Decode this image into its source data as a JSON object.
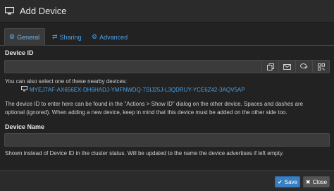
{
  "title": "Add Device",
  "tabs": [
    {
      "label": "General",
      "icon": "gear-icon"
    },
    {
      "label": "Sharing",
      "icon": "share-icon"
    },
    {
      "label": "Advanced",
      "icon": "gears-icon"
    }
  ],
  "device_id": {
    "label": "Device ID",
    "value": "",
    "addon_icons": [
      "copy-icon",
      "envelope-icon",
      "chat-icon",
      "qrcode-icon"
    ]
  },
  "nearby": {
    "intro": "You can also select one of these nearby devices:",
    "devices": [
      "MYEJ7AF-AX656EX-DH6HADJ-YMFNWDQ-7SIJ25J-L3QDRUY-YCE6Z42-3AQV5AP"
    ]
  },
  "help_text": [
    "The device ID to enter here can be found in the \"Actions > Show ID\" dialog on the other device. Spaces and dashes are",
    "optional (ignored). When adding a new device, keep in mind that this device must be added on the other side too."
  ],
  "device_name": {
    "label": "Device Name",
    "value": "",
    "help": "Shown instead of Device ID in the cluster status. Will be updated to the name the device advertises if left empty."
  },
  "footer": {
    "save_label": "Save",
    "close_label": "Close"
  }
}
